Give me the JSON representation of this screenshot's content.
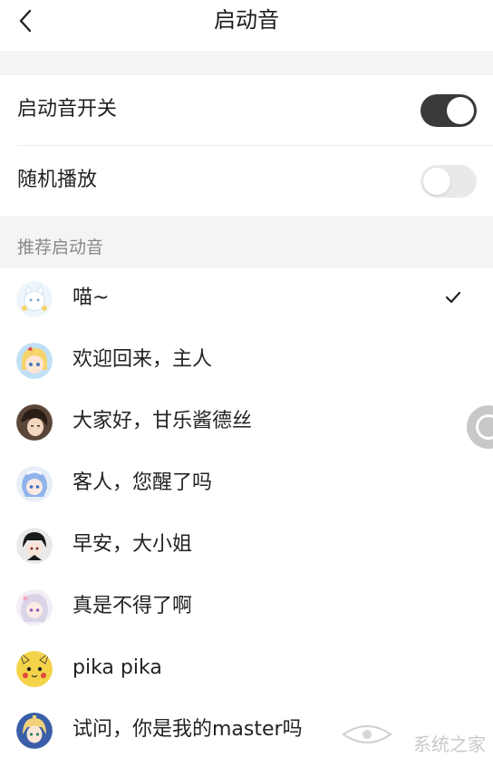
{
  "header": {
    "title": "启动音"
  },
  "settings": {
    "startup_sound": {
      "label": "启动音开关",
      "enabled": true
    },
    "random_play": {
      "label": "随机播放",
      "enabled": false
    }
  },
  "recommended": {
    "section_label": "推荐启动音",
    "items": [
      {
        "label": "喵~",
        "selected": true
      },
      {
        "label": "欢迎回来，主人",
        "selected": false
      },
      {
        "label": "大家好，甘乐酱德丝",
        "selected": false
      },
      {
        "label": "客人，您醒了吗",
        "selected": false
      },
      {
        "label": "早安，大小姐",
        "selected": false
      },
      {
        "label": "真是不得了啊",
        "selected": false
      },
      {
        "label": "pika pika",
        "selected": false
      },
      {
        "label": "试问，你是我的master吗",
        "selected": false
      }
    ]
  },
  "watermark": {
    "text": "系统之家"
  },
  "colors": {
    "toggle_on": "#3a3a3a",
    "toggle_off": "#e9e9e9",
    "section_bg": "#f4f4f4",
    "muted_text": "#888888"
  }
}
